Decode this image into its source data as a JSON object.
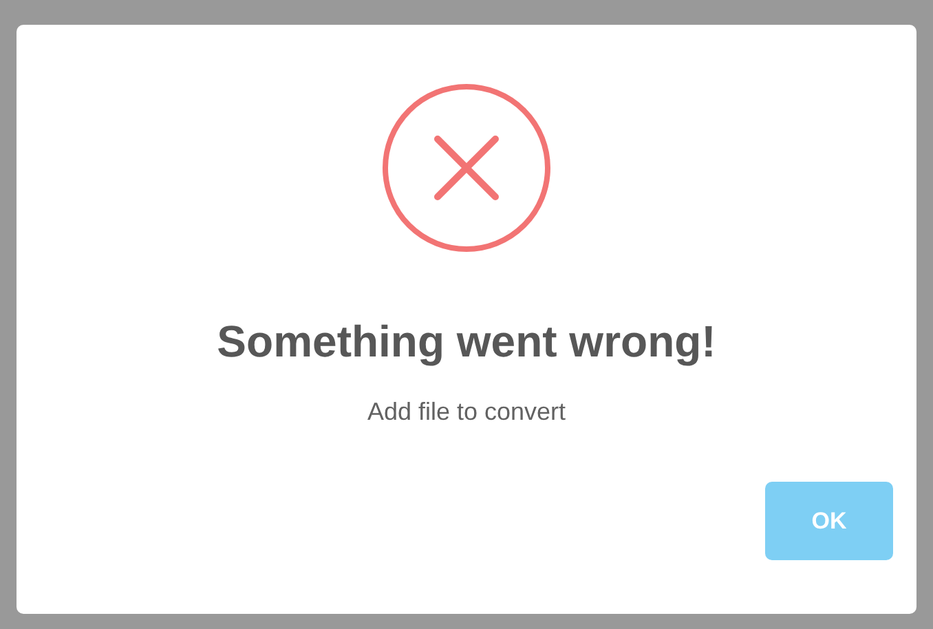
{
  "dialog": {
    "title": "Something went wrong!",
    "message": "Add file to convert",
    "buttons": [
      {
        "label": "OK",
        "kind": "confirm"
      }
    ]
  }
}
